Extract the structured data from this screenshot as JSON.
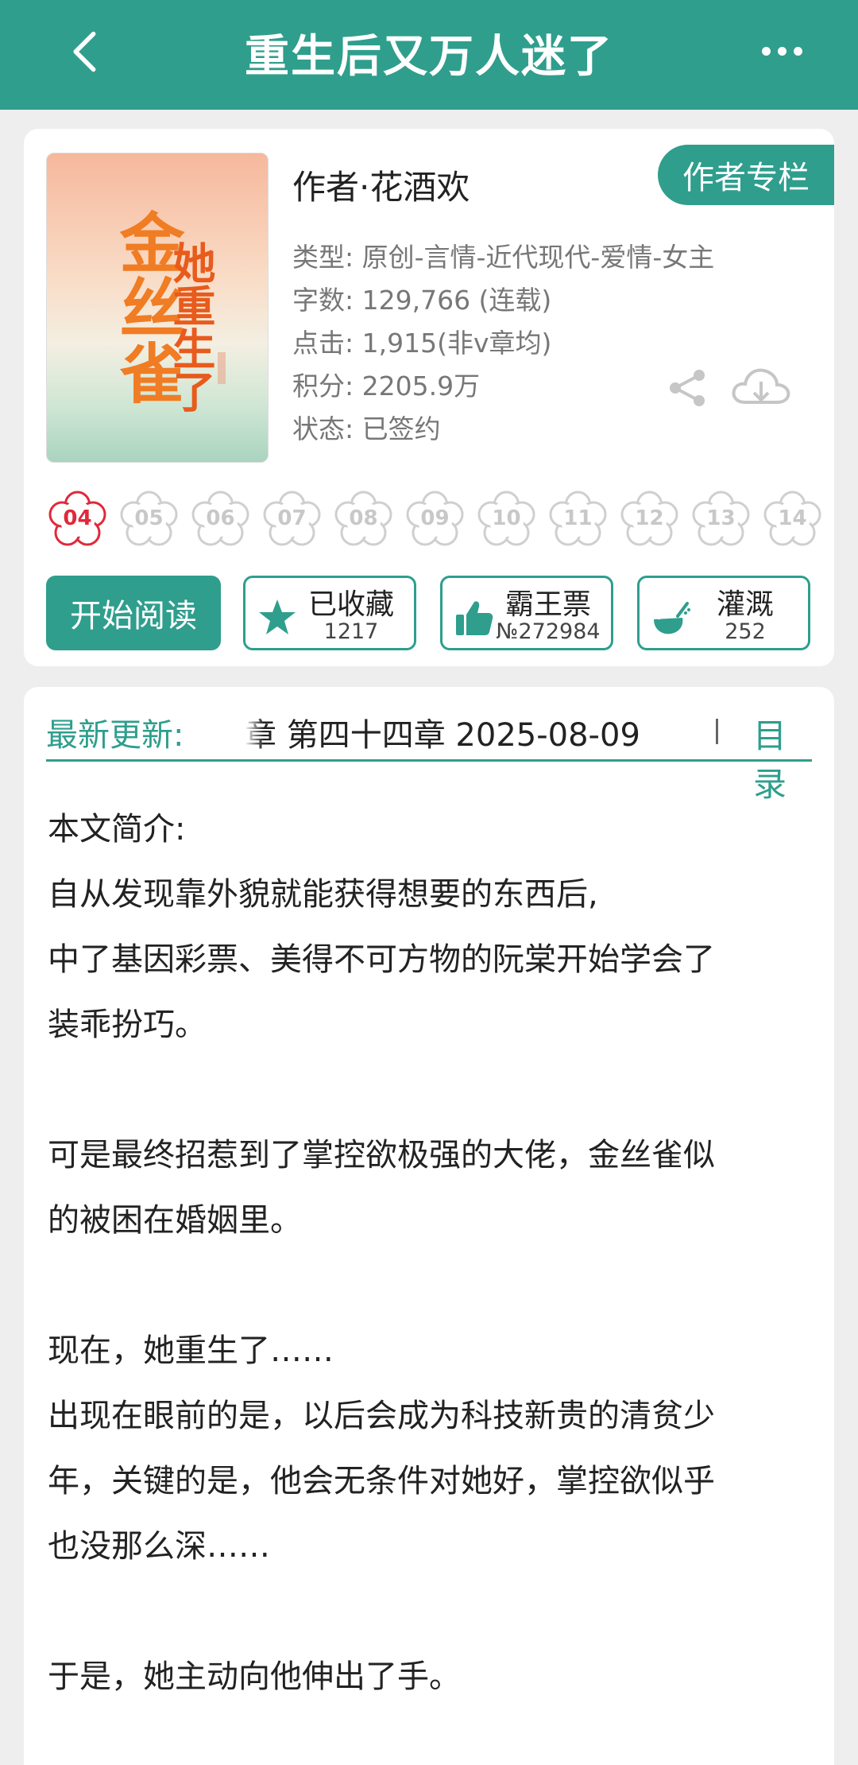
{
  "header": {
    "title": "重生后又万人迷了"
  },
  "book": {
    "cover": {
      "main_title": "金丝雀",
      "sub_title": "她重生了"
    },
    "author": "作者·花酒欢",
    "author_column_label": "作者专栏",
    "meta": {
      "type": "类型: 原创-言情-近代现代-爱情-女主",
      "words": "字数: 129,766 (连载)",
      "clicks": "点击: 1,915(非v章均)",
      "score": "积分: 2205.9万",
      "status": "状态: 已签约"
    },
    "badges": [
      "04",
      "05",
      "06",
      "07",
      "08",
      "09",
      "10",
      "11",
      "12",
      "13",
      "14"
    ],
    "active_badge": "04",
    "actions": {
      "start_reading": "开始阅读",
      "favorite": {
        "label": "已收藏",
        "count": "1217"
      },
      "ticket": {
        "label": "霸王票",
        "count": "№272984"
      },
      "irrigate": {
        "label": "灌溉",
        "count": "252"
      }
    }
  },
  "latest": {
    "label": "最新更新:",
    "text": "章  第四十四章  2025-08-09",
    "toc_label": "目录"
  },
  "intro": {
    "heading": "本文简介:",
    "lines": [
      "自从发现靠外貌就能获得想要的东西后,",
      "中了基因彩票、美得不可方物的阮棠开始学会了",
      "装乖扮巧。",
      "",
      "可是最终招惹到了掌控欲极强的大佬，金丝雀似",
      "的被困在婚姻里。",
      "",
      "现在，她重生了……",
      "出现在眼前的是，以后会成为科技新贵的清贫少",
      "年，关键的是，他会无条件对她好，掌控欲似乎",
      "也没那么深……",
      "",
      "于是，她主动向他伸出了手。"
    ]
  },
  "colors": {
    "accent": "#2f9e8d",
    "badge_active": "#e0293b"
  },
  "icons": [
    "back-arrow-icon",
    "more-dots-icon",
    "share-icon",
    "cloud-download-icon",
    "flower-badge-icon",
    "star-icon",
    "thumbs-up-icon",
    "watering-can-icon"
  ]
}
